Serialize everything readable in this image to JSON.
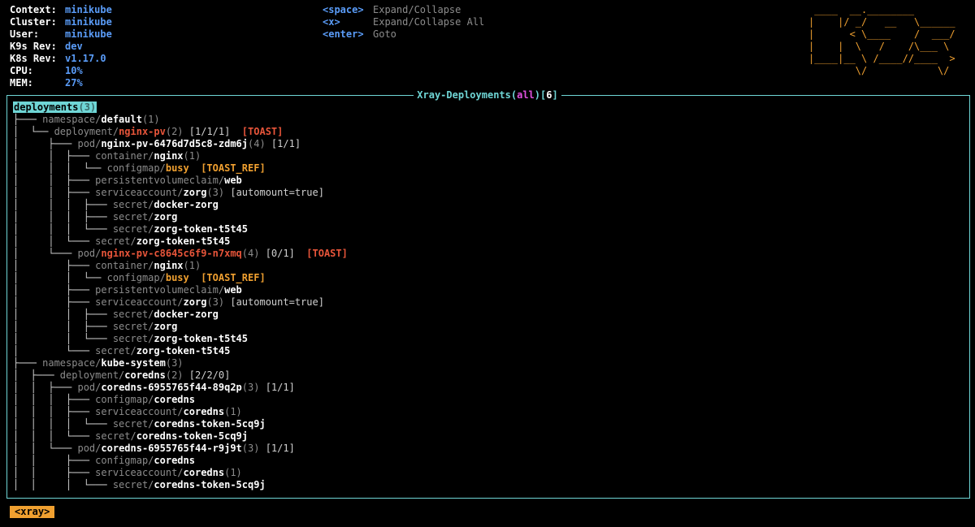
{
  "cluster_info": [
    {
      "label": "Context:",
      "value": "minikube"
    },
    {
      "label": "Cluster:",
      "value": "minikube"
    },
    {
      "label": "User:",
      "value": "minikube"
    },
    {
      "label": "K9s Rev:",
      "value": "dev"
    },
    {
      "label": "K8s Rev:",
      "value": "v1.17.0"
    },
    {
      "label": "CPU:",
      "value": "10%"
    },
    {
      "label": "MEM:",
      "value": "27%"
    }
  ],
  "help": [
    {
      "key": "<space>",
      "desc": "Expand/Collapse"
    },
    {
      "key": "<x>",
      "desc": "Expand/Collapse All"
    },
    {
      "key": "<enter>",
      "desc": "Goto"
    }
  ],
  "logo": " ____  __.________       \n|    |/ _/   __   \\______\n|      < \\____    /  ___/\n|    |  \\   /    /\\___ \\ \n|____|__ \\ /____//____  >\n        \\/            \\/ ",
  "title": {
    "prefix": "Xray-Deployments(",
    "filter": "all",
    "mid": ")[",
    "count": "6",
    "suffix": "]"
  },
  "tree": [
    {
      "g": "",
      "kind": "",
      "name": "deployments",
      "cnt": "(3)",
      "selected": true
    },
    {
      "g": "├─── ",
      "kind": "namespace/",
      "name": "default",
      "cnt": "(1)"
    },
    {
      "g": "│  └── ",
      "kind": "deployment/",
      "name": "nginx-pv",
      "nameColor": "red",
      "cnt": "(2)",
      "ext": " [1/1/1]",
      "tag": "  [TOAST]",
      "tagColor": "r"
    },
    {
      "g": "│     ├─── ",
      "kind": "pod/",
      "name": "nginx-pv-6476d7d5c8-zdm6j",
      "cnt": "(4)",
      "ext": " [1/1]"
    },
    {
      "g": "│     │  ├─── ",
      "kind": "container/",
      "name": "nginx",
      "cnt": "(1)"
    },
    {
      "g": "│     │  │  └── ",
      "kind": "configmap/",
      "name": "busy",
      "nameColor": "orange",
      "cnt": "",
      "tag": "  [TOAST_REF]",
      "tagColor": "o"
    },
    {
      "g": "│     │  ├─── ",
      "kind": "persistentvolumeclaim/",
      "name": "web",
      "cnt": ""
    },
    {
      "g": "│     │  ├─── ",
      "kind": "serviceaccount/",
      "name": "zorg",
      "cnt": "(3)",
      "ext": " [automount=true]"
    },
    {
      "g": "│     │  │  ├─── ",
      "kind": "secret/",
      "name": "docker-zorg",
      "cnt": ""
    },
    {
      "g": "│     │  │  ├─── ",
      "kind": "secret/",
      "name": "zorg",
      "cnt": ""
    },
    {
      "g": "│     │  │  └─── ",
      "kind": "secret/",
      "name": "zorg-token-t5t45",
      "cnt": ""
    },
    {
      "g": "│     │  └─── ",
      "kind": "secret/",
      "name": "zorg-token-t5t45",
      "cnt": ""
    },
    {
      "g": "│     └─── ",
      "kind": "pod/",
      "name": "nginx-pv-c8645c6f9-n7xmq",
      "nameColor": "red",
      "cnt": "(4)",
      "ext": " [0/1]",
      "tag": "  [TOAST]",
      "tagColor": "r"
    },
    {
      "g": "│        ├─── ",
      "kind": "container/",
      "name": "nginx",
      "cnt": "(1)"
    },
    {
      "g": "│        │  └── ",
      "kind": "configmap/",
      "name": "busy",
      "nameColor": "orange",
      "cnt": "",
      "tag": "  [TOAST_REF]",
      "tagColor": "o"
    },
    {
      "g": "│        ├─── ",
      "kind": "persistentvolumeclaim/",
      "name": "web",
      "cnt": ""
    },
    {
      "g": "│        ├─── ",
      "kind": "serviceaccount/",
      "name": "zorg",
      "cnt": "(3)",
      "ext": " [automount=true]"
    },
    {
      "g": "│        │  ├─── ",
      "kind": "secret/",
      "name": "docker-zorg",
      "cnt": ""
    },
    {
      "g": "│        │  ├─── ",
      "kind": "secret/",
      "name": "zorg",
      "cnt": ""
    },
    {
      "g": "│        │  └─── ",
      "kind": "secret/",
      "name": "zorg-token-t5t45",
      "cnt": ""
    },
    {
      "g": "│        └─── ",
      "kind": "secret/",
      "name": "zorg-token-t5t45",
      "cnt": ""
    },
    {
      "g": "├─── ",
      "kind": "namespace/",
      "name": "kube-system",
      "cnt": "(3)"
    },
    {
      "g": "│  ├─── ",
      "kind": "deployment/",
      "name": "coredns",
      "cnt": "(2)",
      "ext": " [2/2/0]"
    },
    {
      "g": "│  │  ├─── ",
      "kind": "pod/",
      "name": "coredns-6955765f44-89q2p",
      "cnt": "(3)",
      "ext": " [1/1]"
    },
    {
      "g": "│  │  │  ├─── ",
      "kind": "configmap/",
      "name": "coredns",
      "cnt": ""
    },
    {
      "g": "│  │  │  ├─── ",
      "kind": "serviceaccount/",
      "name": "coredns",
      "cnt": "(1)"
    },
    {
      "g": "│  │  │  │  └─── ",
      "kind": "secret/",
      "name": "coredns-token-5cq9j",
      "cnt": ""
    },
    {
      "g": "│  │  │  └─── ",
      "kind": "secret/",
      "name": "coredns-token-5cq9j",
      "cnt": ""
    },
    {
      "g": "│  │  └─── ",
      "kind": "pod/",
      "name": "coredns-6955765f44-r9j9t",
      "cnt": "(3)",
      "ext": " [1/1]"
    },
    {
      "g": "│  │     ├─── ",
      "kind": "configmap/",
      "name": "coredns",
      "cnt": ""
    },
    {
      "g": "│  │     ├─── ",
      "kind": "serviceaccount/",
      "name": "coredns",
      "cnt": "(1)"
    },
    {
      "g": "│  │     │  └─── ",
      "kind": "secret/",
      "name": "coredns-token-5cq9j",
      "cnt": ""
    }
  ],
  "crumb": "<xray>",
  "colors": {
    "accent": "#6fd6d6",
    "orange": "#f0a030",
    "red": "#e8553a",
    "blue": "#5a9cf8",
    "pink": "#e050e0"
  }
}
